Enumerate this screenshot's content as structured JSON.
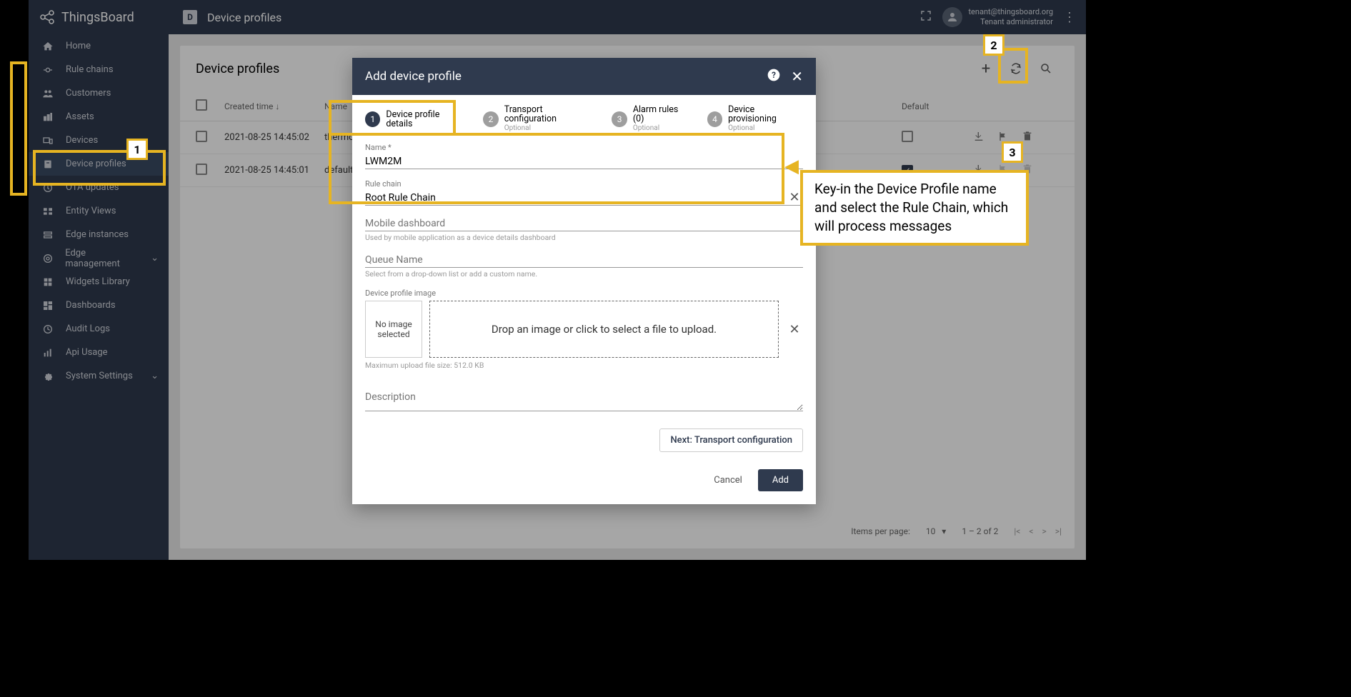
{
  "header": {
    "brand": "ThingsBoard",
    "page_title": "Device profiles",
    "user_email": "tenant@thingsboard.org",
    "user_role": "Tenant administrator"
  },
  "sidebar": {
    "items": [
      {
        "label": "Home"
      },
      {
        "label": "Rule chains"
      },
      {
        "label": "Customers"
      },
      {
        "label": "Assets"
      },
      {
        "label": "Devices"
      },
      {
        "label": "Device profiles"
      },
      {
        "label": "OTA updates"
      },
      {
        "label": "Entity Views"
      },
      {
        "label": "Edge instances"
      },
      {
        "label": "Edge management"
      },
      {
        "label": "Widgets Library"
      },
      {
        "label": "Dashboards"
      },
      {
        "label": "Audit Logs"
      },
      {
        "label": "Api Usage"
      },
      {
        "label": "System Settings"
      }
    ]
  },
  "table": {
    "title": "Device profiles",
    "columns": {
      "time": "Created time",
      "name": "Name",
      "default": "Default"
    },
    "rows": [
      {
        "time": "2021-08-25 14:45:02",
        "name": "thermo",
        "default": false
      },
      {
        "time": "2021-08-25 14:45:01",
        "name": "default",
        "default": true
      }
    ]
  },
  "paginator": {
    "label": "Items per page:",
    "size": "10",
    "range": "1 – 2 of 2"
  },
  "dialog": {
    "title": "Add device profile",
    "steps": [
      {
        "num": "1",
        "label": "Device profile details",
        "optional": ""
      },
      {
        "num": "2",
        "label": "Transport configuration",
        "optional": "Optional"
      },
      {
        "num": "3",
        "label": "Alarm rules (0)",
        "optional": "Optional"
      },
      {
        "num": "4",
        "label": "Device provisioning",
        "optional": "Optional"
      }
    ],
    "name_field": {
      "label": "Name *",
      "value": "LWM2M"
    },
    "rule_field": {
      "label": "Rule chain",
      "value": "Root Rule Chain"
    },
    "mobile_field": {
      "label": "Mobile dashboard",
      "helper": "Used by mobile application as a device details dashboard"
    },
    "queue_field": {
      "label": "Queue Name",
      "helper": "Select from a drop-down list or add a custom name."
    },
    "image": {
      "section_label": "Device profile image",
      "noimg": "No image selected",
      "drop": "Drop an image or click to select a file to upload.",
      "max": "Maximum upload file size: 512.0 KB"
    },
    "description_label": "Description",
    "next_btn": "Next: Transport configuration",
    "cancel_btn": "Cancel",
    "add_btn": "Add"
  },
  "annotations": {
    "n1": "1",
    "n2": "2",
    "n3": "3",
    "callout": "Key-in the Device Profile name and select the Rule Chain, which will process messages"
  }
}
